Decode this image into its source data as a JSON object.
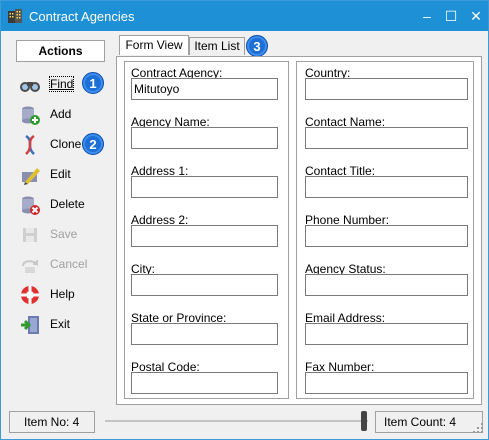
{
  "window": {
    "title": "Contract Agencies",
    "icon": "building-icon",
    "controls": {
      "minimize": "–",
      "maximize": "☐",
      "close": "✕"
    }
  },
  "sidebar": {
    "header": "Actions",
    "items": [
      {
        "label": "Find",
        "icon": "binoculars-icon",
        "enabled": true
      },
      {
        "label": "Add",
        "icon": "database-add-icon",
        "enabled": true
      },
      {
        "label": "Clone",
        "icon": "dna-icon",
        "enabled": true
      },
      {
        "label": "Edit",
        "icon": "pencil-icon",
        "enabled": true
      },
      {
        "label": "Delete",
        "icon": "database-delete-icon",
        "enabled": true
      },
      {
        "label": "Save",
        "icon": "save-icon",
        "enabled": false
      },
      {
        "label": "Cancel",
        "icon": "cancel-icon",
        "enabled": false
      },
      {
        "label": "Help",
        "icon": "lifebuoy-icon",
        "enabled": true
      },
      {
        "label": "Exit",
        "icon": "exit-door-icon",
        "enabled": true
      }
    ]
  },
  "badges": [
    "1",
    "2",
    "3"
  ],
  "tabs": [
    {
      "label": "Form View",
      "active": true
    },
    {
      "label": "Item List",
      "active": false
    }
  ],
  "form": {
    "left": [
      {
        "label": "Contract Agency:",
        "value": "Mitutoyo"
      },
      {
        "label": "Agency Name:",
        "value": ""
      },
      {
        "label": "Address 1:",
        "value": ""
      },
      {
        "label": "Address 2:",
        "value": ""
      },
      {
        "label": "City:",
        "value": ""
      },
      {
        "label": "State or Province:",
        "value": ""
      },
      {
        "label": "Postal Code:",
        "value": ""
      }
    ],
    "right": [
      {
        "label": "Country:",
        "value": ""
      },
      {
        "label": "Contact Name:",
        "value": ""
      },
      {
        "label": "Contact Title:",
        "value": ""
      },
      {
        "label": "Phone Number:",
        "value": ""
      },
      {
        "label": "Agency Status:",
        "value": ""
      },
      {
        "label": "Email Address:",
        "value": ""
      },
      {
        "label": "Fax Number:",
        "value": ""
      }
    ]
  },
  "status": {
    "item_no": "Item No: 4",
    "item_count": "Item Count: 4"
  }
}
